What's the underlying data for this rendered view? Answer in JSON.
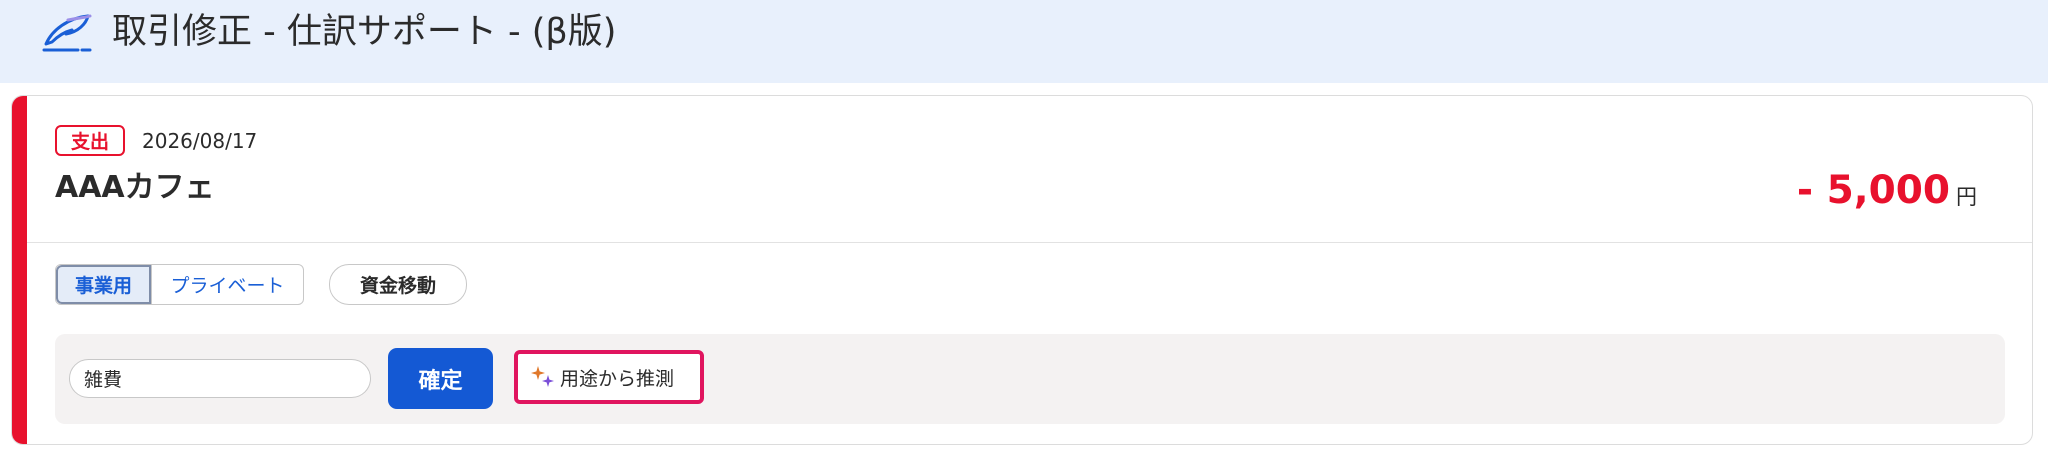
{
  "header": {
    "title": "取引修正 - 仕訳サポート - (β版)",
    "logo_icon": "quill-logo-icon"
  },
  "transaction": {
    "type_badge": "支出",
    "date": "2026/08/17",
    "payee": "AAAカフェ",
    "amount": "- 5,000",
    "currency": "円"
  },
  "usage_toggle": {
    "options": [
      "事業用",
      "プライベート"
    ],
    "selected": "事業用"
  },
  "transfer_button": "資金移動",
  "category": {
    "value": "雑費",
    "placeholder": ""
  },
  "confirm_button": "確定",
  "infer_button": {
    "label": "用途から推測",
    "icon": "sparkle-icon"
  },
  "colors": {
    "header_bg": "#e8f0fc",
    "expense_red": "#e8112d",
    "primary_blue": "#1459d4",
    "highlight_pink": "#e0155f"
  }
}
